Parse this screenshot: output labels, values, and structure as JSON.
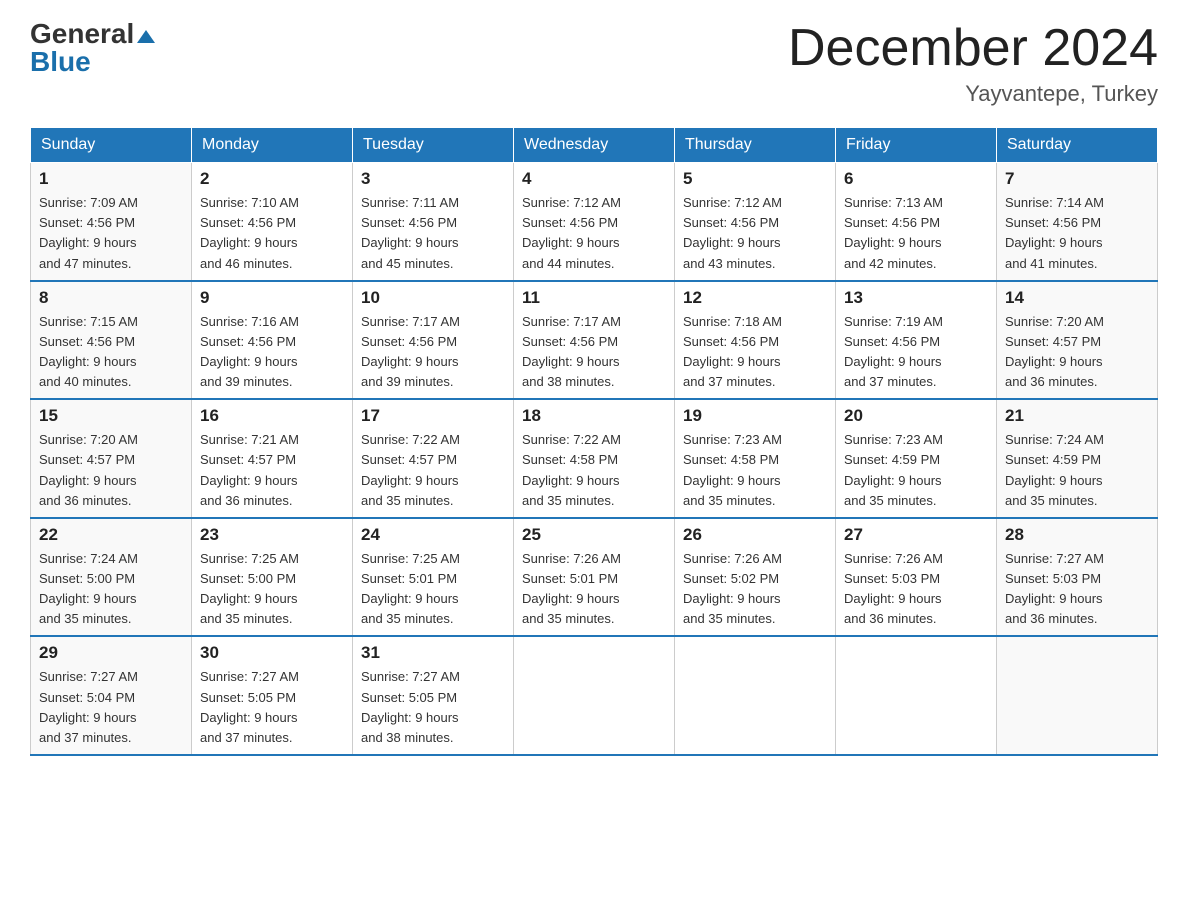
{
  "logo": {
    "general": "General",
    "blue": "Blue"
  },
  "title": "December 2024",
  "location": "Yayvantepe, Turkey",
  "days_of_week": [
    "Sunday",
    "Monday",
    "Tuesday",
    "Wednesday",
    "Thursday",
    "Friday",
    "Saturday"
  ],
  "weeks": [
    [
      {
        "day": "1",
        "sunrise": "7:09 AM",
        "sunset": "4:56 PM",
        "daylight": "9 hours and 47 minutes."
      },
      {
        "day": "2",
        "sunrise": "7:10 AM",
        "sunset": "4:56 PM",
        "daylight": "9 hours and 46 minutes."
      },
      {
        "day": "3",
        "sunrise": "7:11 AM",
        "sunset": "4:56 PM",
        "daylight": "9 hours and 45 minutes."
      },
      {
        "day": "4",
        "sunrise": "7:12 AM",
        "sunset": "4:56 PM",
        "daylight": "9 hours and 44 minutes."
      },
      {
        "day": "5",
        "sunrise": "7:12 AM",
        "sunset": "4:56 PM",
        "daylight": "9 hours and 43 minutes."
      },
      {
        "day": "6",
        "sunrise": "7:13 AM",
        "sunset": "4:56 PM",
        "daylight": "9 hours and 42 minutes."
      },
      {
        "day": "7",
        "sunrise": "7:14 AM",
        "sunset": "4:56 PM",
        "daylight": "9 hours and 41 minutes."
      }
    ],
    [
      {
        "day": "8",
        "sunrise": "7:15 AM",
        "sunset": "4:56 PM",
        "daylight": "9 hours and 40 minutes."
      },
      {
        "day": "9",
        "sunrise": "7:16 AM",
        "sunset": "4:56 PM",
        "daylight": "9 hours and 39 minutes."
      },
      {
        "day": "10",
        "sunrise": "7:17 AM",
        "sunset": "4:56 PM",
        "daylight": "9 hours and 39 minutes."
      },
      {
        "day": "11",
        "sunrise": "7:17 AM",
        "sunset": "4:56 PM",
        "daylight": "9 hours and 38 minutes."
      },
      {
        "day": "12",
        "sunrise": "7:18 AM",
        "sunset": "4:56 PM",
        "daylight": "9 hours and 37 minutes."
      },
      {
        "day": "13",
        "sunrise": "7:19 AM",
        "sunset": "4:56 PM",
        "daylight": "9 hours and 37 minutes."
      },
      {
        "day": "14",
        "sunrise": "7:20 AM",
        "sunset": "4:57 PM",
        "daylight": "9 hours and 36 minutes."
      }
    ],
    [
      {
        "day": "15",
        "sunrise": "7:20 AM",
        "sunset": "4:57 PM",
        "daylight": "9 hours and 36 minutes."
      },
      {
        "day": "16",
        "sunrise": "7:21 AM",
        "sunset": "4:57 PM",
        "daylight": "9 hours and 36 minutes."
      },
      {
        "day": "17",
        "sunrise": "7:22 AM",
        "sunset": "4:57 PM",
        "daylight": "9 hours and 35 minutes."
      },
      {
        "day": "18",
        "sunrise": "7:22 AM",
        "sunset": "4:58 PM",
        "daylight": "9 hours and 35 minutes."
      },
      {
        "day": "19",
        "sunrise": "7:23 AM",
        "sunset": "4:58 PM",
        "daylight": "9 hours and 35 minutes."
      },
      {
        "day": "20",
        "sunrise": "7:23 AM",
        "sunset": "4:59 PM",
        "daylight": "9 hours and 35 minutes."
      },
      {
        "day": "21",
        "sunrise": "7:24 AM",
        "sunset": "4:59 PM",
        "daylight": "9 hours and 35 minutes."
      }
    ],
    [
      {
        "day": "22",
        "sunrise": "7:24 AM",
        "sunset": "5:00 PM",
        "daylight": "9 hours and 35 minutes."
      },
      {
        "day": "23",
        "sunrise": "7:25 AM",
        "sunset": "5:00 PM",
        "daylight": "9 hours and 35 minutes."
      },
      {
        "day": "24",
        "sunrise": "7:25 AM",
        "sunset": "5:01 PM",
        "daylight": "9 hours and 35 minutes."
      },
      {
        "day": "25",
        "sunrise": "7:26 AM",
        "sunset": "5:01 PM",
        "daylight": "9 hours and 35 minutes."
      },
      {
        "day": "26",
        "sunrise": "7:26 AM",
        "sunset": "5:02 PM",
        "daylight": "9 hours and 35 minutes."
      },
      {
        "day": "27",
        "sunrise": "7:26 AM",
        "sunset": "5:03 PM",
        "daylight": "9 hours and 36 minutes."
      },
      {
        "day": "28",
        "sunrise": "7:27 AM",
        "sunset": "5:03 PM",
        "daylight": "9 hours and 36 minutes."
      }
    ],
    [
      {
        "day": "29",
        "sunrise": "7:27 AM",
        "sunset": "5:04 PM",
        "daylight": "9 hours and 37 minutes."
      },
      {
        "day": "30",
        "sunrise": "7:27 AM",
        "sunset": "5:05 PM",
        "daylight": "9 hours and 37 minutes."
      },
      {
        "day": "31",
        "sunrise": "7:27 AM",
        "sunset": "5:05 PM",
        "daylight": "9 hours and 38 minutes."
      },
      null,
      null,
      null,
      null
    ]
  ],
  "labels": {
    "sunrise": "Sunrise:",
    "sunset": "Sunset:",
    "daylight": "Daylight:"
  },
  "colors": {
    "header_bg": "#2176b8",
    "header_text": "#ffffff",
    "border": "#2176b8"
  }
}
